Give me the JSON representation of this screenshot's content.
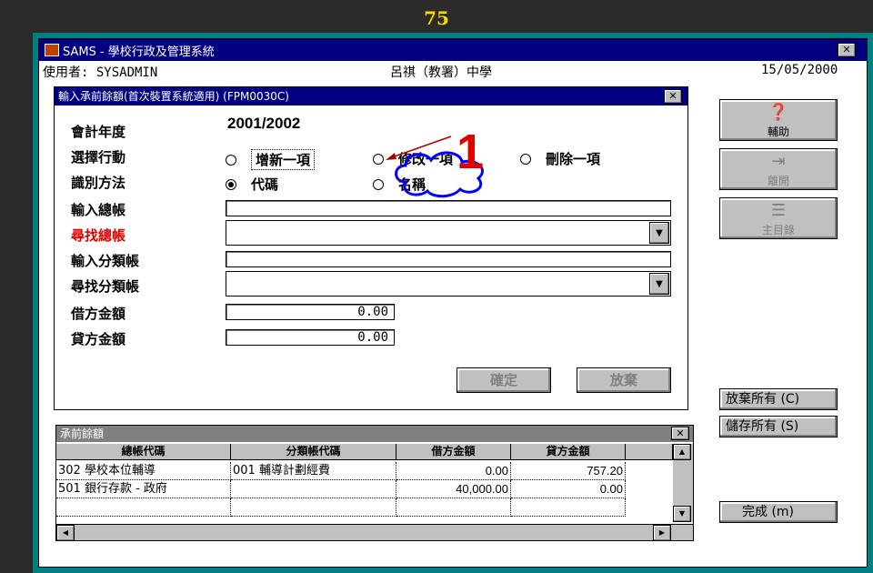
{
  "slide": {
    "number": "75"
  },
  "app": {
    "title": "SAMS - 學校行政及管理系統",
    "user_label": "使用者: SYSADMIN",
    "school": "呂祺（教署）中學",
    "date": "15/05/2000"
  },
  "dialog": {
    "title": "輸入承前餘額(首次裝置系統適用) (FPM0030C)",
    "labels": {
      "fiscal_year": "會計年度",
      "action": "選擇行動",
      "identify": "識別方法",
      "input_gl": "輸入總帳",
      "find_gl": "尋找總帳",
      "input_sub": "輸入分類帳",
      "find_sub": "尋找分類帳",
      "debit": "借方金額",
      "credit": "貸方金額"
    },
    "fiscal_year_value": "2001/2002",
    "action_options": [
      "增新一項",
      "修改一項",
      "刪除一項"
    ],
    "identify_options": [
      "代碼",
      "名稱"
    ],
    "debit_value": "0.00",
    "credit_value": "0.00",
    "confirm_label": "確定",
    "discard_label": "放棄",
    "annotation_number": "1"
  },
  "toolbar": {
    "help_label": "輔助",
    "exit_label": "離開",
    "main_menu_label": "主目錄",
    "discard_all_label": "放棄所有 (C)",
    "save_all_label": "儲存所有 (S)",
    "finish_label": "完成 (m)"
  },
  "grid": {
    "title": "承前餘額",
    "headers": [
      "總帳代碼",
      "分類帳代碼",
      "借方金額",
      "貸方金額"
    ],
    "rows": [
      {
        "gl": "302 學校本位輔導",
        "sub": "001 輔導計劃經費",
        "debit": "0.00",
        "credit": "757.20"
      },
      {
        "gl": "501 銀行存款 - 政府",
        "sub": "",
        "debit": "40,000.00",
        "credit": "0.00"
      }
    ]
  },
  "colors": {
    "titlebar": "#000080",
    "frame": "#008080",
    "button_face": "#c0c0c0",
    "annotation_red": "#e00000"
  }
}
